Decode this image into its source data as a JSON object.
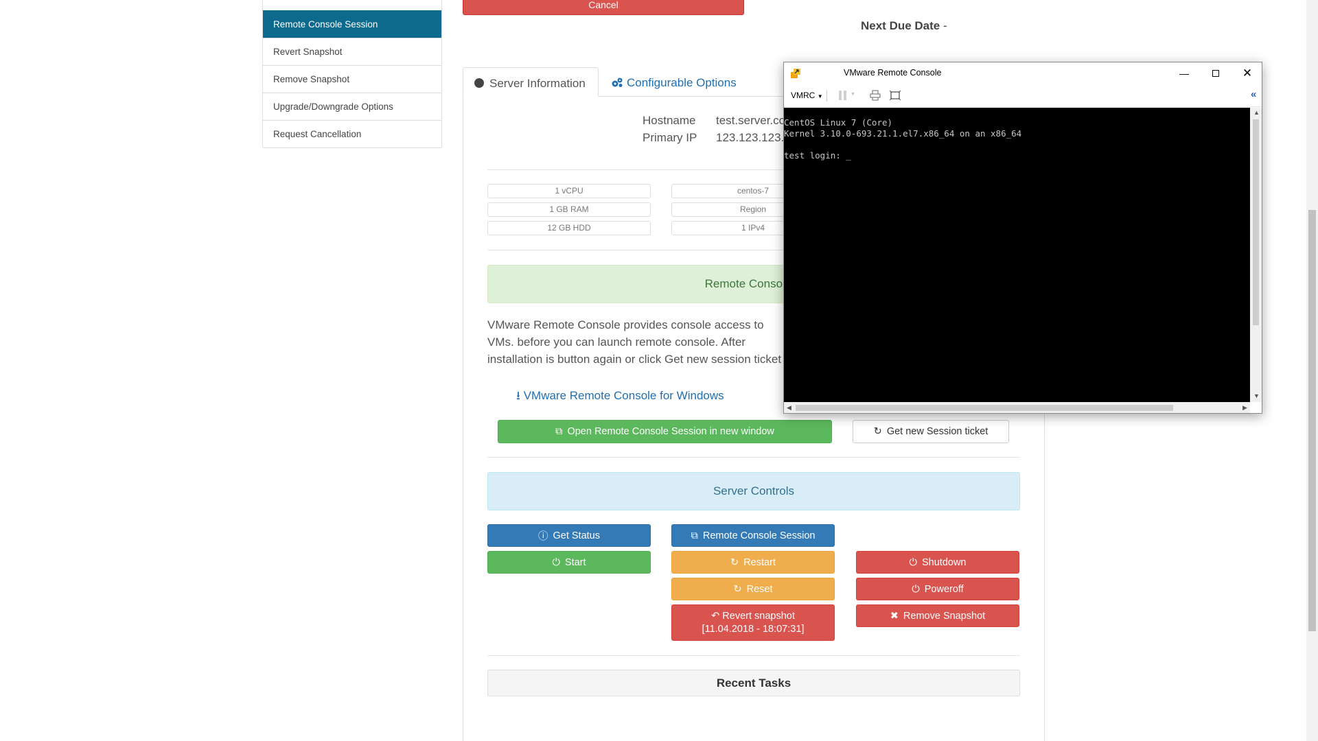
{
  "sidebar": {
    "items": [
      {
        "label": "Remote Console Session",
        "active": true
      },
      {
        "label": "Revert Snapshot"
      },
      {
        "label": "Remove Snapshot"
      },
      {
        "label": "Upgrade/Downgrade Options"
      },
      {
        "label": "Request Cancellation"
      }
    ]
  },
  "header": {
    "cancel_label": "Cancel",
    "next_due_label": "Next Due Date",
    "next_due_value": "-"
  },
  "tabs": [
    {
      "label": "Server Information",
      "active": true,
      "icon": "globe-icon"
    },
    {
      "label": "Configurable Options",
      "icon": "cogs-icon"
    }
  ],
  "server_info": {
    "hostname_label": "Hostname",
    "hostname_value": "test.server.co",
    "ip_label": "Primary IP",
    "ip_value": "123.123.123."
  },
  "specs": {
    "left": [
      "1 vCPU",
      "1 GB RAM",
      "12 GB HDD"
    ],
    "right": [
      "centos-7",
      "Region",
      "1 IPv4"
    ]
  },
  "remote_console": {
    "alert_text": "Remote Console S",
    "description": "VMware Remote Console provides console access to VMs. before you can launch remote console. After installation is button again or click Get new session ticket",
    "download_link": "VMware Remote Console for Windows",
    "open_button": "Open Remote Console Session in new window",
    "ticket_button": "Get new Session ticket"
  },
  "server_controls": {
    "title": "Server Controls",
    "get_status": "Get Status",
    "remote_console_session": "Remote Console Session",
    "start": "Start",
    "restart": "Restart",
    "shutdown": "Shutdown",
    "reset": "Reset",
    "poweroff": "Poweroff",
    "revert_snapshot": "Revert snapshot",
    "revert_snapshot_date": "[11.04.2018 - 18:07:31]",
    "remove_snapshot": "Remove Snapshot"
  },
  "recent_tasks": {
    "title": "Recent Tasks"
  },
  "vmrc": {
    "title": "VMware Remote Console",
    "menu_label": "VMRC",
    "terminal_lines": [
      "CentOS Linux 7 (Core)",
      "Kernel 3.10.0-693.21.1.el7.x86_64 on an x86_64",
      "",
      "test login: _"
    ]
  },
  "colors": {
    "sidebar_active": "#0e6a8c",
    "green": "#5cb85c",
    "blue": "#337ab7",
    "orange": "#f0ad4e",
    "red": "#d9534f",
    "link": "#1f6fb2"
  }
}
